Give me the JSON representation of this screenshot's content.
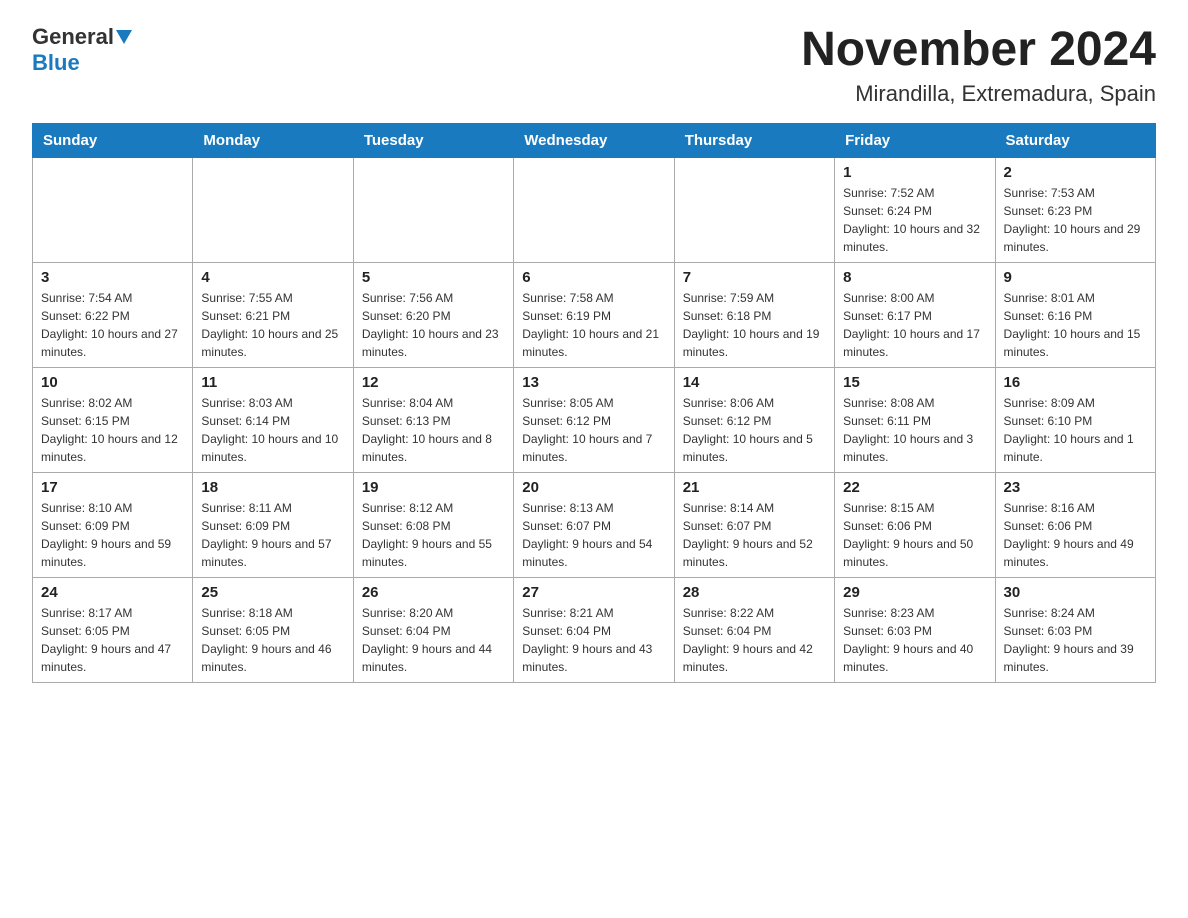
{
  "header": {
    "logo_general": "General",
    "logo_blue": "Blue",
    "title": "November 2024",
    "subtitle": "Mirandilla, Extremadura, Spain"
  },
  "weekdays": [
    "Sunday",
    "Monday",
    "Tuesday",
    "Wednesday",
    "Thursday",
    "Friday",
    "Saturday"
  ],
  "weeks": [
    [
      {
        "day": "",
        "info": ""
      },
      {
        "day": "",
        "info": ""
      },
      {
        "day": "",
        "info": ""
      },
      {
        "day": "",
        "info": ""
      },
      {
        "day": "",
        "info": ""
      },
      {
        "day": "1",
        "info": "Sunrise: 7:52 AM\nSunset: 6:24 PM\nDaylight: 10 hours and 32 minutes."
      },
      {
        "day": "2",
        "info": "Sunrise: 7:53 AM\nSunset: 6:23 PM\nDaylight: 10 hours and 29 minutes."
      }
    ],
    [
      {
        "day": "3",
        "info": "Sunrise: 7:54 AM\nSunset: 6:22 PM\nDaylight: 10 hours and 27 minutes."
      },
      {
        "day": "4",
        "info": "Sunrise: 7:55 AM\nSunset: 6:21 PM\nDaylight: 10 hours and 25 minutes."
      },
      {
        "day": "5",
        "info": "Sunrise: 7:56 AM\nSunset: 6:20 PM\nDaylight: 10 hours and 23 minutes."
      },
      {
        "day": "6",
        "info": "Sunrise: 7:58 AM\nSunset: 6:19 PM\nDaylight: 10 hours and 21 minutes."
      },
      {
        "day": "7",
        "info": "Sunrise: 7:59 AM\nSunset: 6:18 PM\nDaylight: 10 hours and 19 minutes."
      },
      {
        "day": "8",
        "info": "Sunrise: 8:00 AM\nSunset: 6:17 PM\nDaylight: 10 hours and 17 minutes."
      },
      {
        "day": "9",
        "info": "Sunrise: 8:01 AM\nSunset: 6:16 PM\nDaylight: 10 hours and 15 minutes."
      }
    ],
    [
      {
        "day": "10",
        "info": "Sunrise: 8:02 AM\nSunset: 6:15 PM\nDaylight: 10 hours and 12 minutes."
      },
      {
        "day": "11",
        "info": "Sunrise: 8:03 AM\nSunset: 6:14 PM\nDaylight: 10 hours and 10 minutes."
      },
      {
        "day": "12",
        "info": "Sunrise: 8:04 AM\nSunset: 6:13 PM\nDaylight: 10 hours and 8 minutes."
      },
      {
        "day": "13",
        "info": "Sunrise: 8:05 AM\nSunset: 6:12 PM\nDaylight: 10 hours and 7 minutes."
      },
      {
        "day": "14",
        "info": "Sunrise: 8:06 AM\nSunset: 6:12 PM\nDaylight: 10 hours and 5 minutes."
      },
      {
        "day": "15",
        "info": "Sunrise: 8:08 AM\nSunset: 6:11 PM\nDaylight: 10 hours and 3 minutes."
      },
      {
        "day": "16",
        "info": "Sunrise: 8:09 AM\nSunset: 6:10 PM\nDaylight: 10 hours and 1 minute."
      }
    ],
    [
      {
        "day": "17",
        "info": "Sunrise: 8:10 AM\nSunset: 6:09 PM\nDaylight: 9 hours and 59 minutes."
      },
      {
        "day": "18",
        "info": "Sunrise: 8:11 AM\nSunset: 6:09 PM\nDaylight: 9 hours and 57 minutes."
      },
      {
        "day": "19",
        "info": "Sunrise: 8:12 AM\nSunset: 6:08 PM\nDaylight: 9 hours and 55 minutes."
      },
      {
        "day": "20",
        "info": "Sunrise: 8:13 AM\nSunset: 6:07 PM\nDaylight: 9 hours and 54 minutes."
      },
      {
        "day": "21",
        "info": "Sunrise: 8:14 AM\nSunset: 6:07 PM\nDaylight: 9 hours and 52 minutes."
      },
      {
        "day": "22",
        "info": "Sunrise: 8:15 AM\nSunset: 6:06 PM\nDaylight: 9 hours and 50 minutes."
      },
      {
        "day": "23",
        "info": "Sunrise: 8:16 AM\nSunset: 6:06 PM\nDaylight: 9 hours and 49 minutes."
      }
    ],
    [
      {
        "day": "24",
        "info": "Sunrise: 8:17 AM\nSunset: 6:05 PM\nDaylight: 9 hours and 47 minutes."
      },
      {
        "day": "25",
        "info": "Sunrise: 8:18 AM\nSunset: 6:05 PM\nDaylight: 9 hours and 46 minutes."
      },
      {
        "day": "26",
        "info": "Sunrise: 8:20 AM\nSunset: 6:04 PM\nDaylight: 9 hours and 44 minutes."
      },
      {
        "day": "27",
        "info": "Sunrise: 8:21 AM\nSunset: 6:04 PM\nDaylight: 9 hours and 43 minutes."
      },
      {
        "day": "28",
        "info": "Sunrise: 8:22 AM\nSunset: 6:04 PM\nDaylight: 9 hours and 42 minutes."
      },
      {
        "day": "29",
        "info": "Sunrise: 8:23 AM\nSunset: 6:03 PM\nDaylight: 9 hours and 40 minutes."
      },
      {
        "day": "30",
        "info": "Sunrise: 8:24 AM\nSunset: 6:03 PM\nDaylight: 9 hours and 39 minutes."
      }
    ]
  ]
}
